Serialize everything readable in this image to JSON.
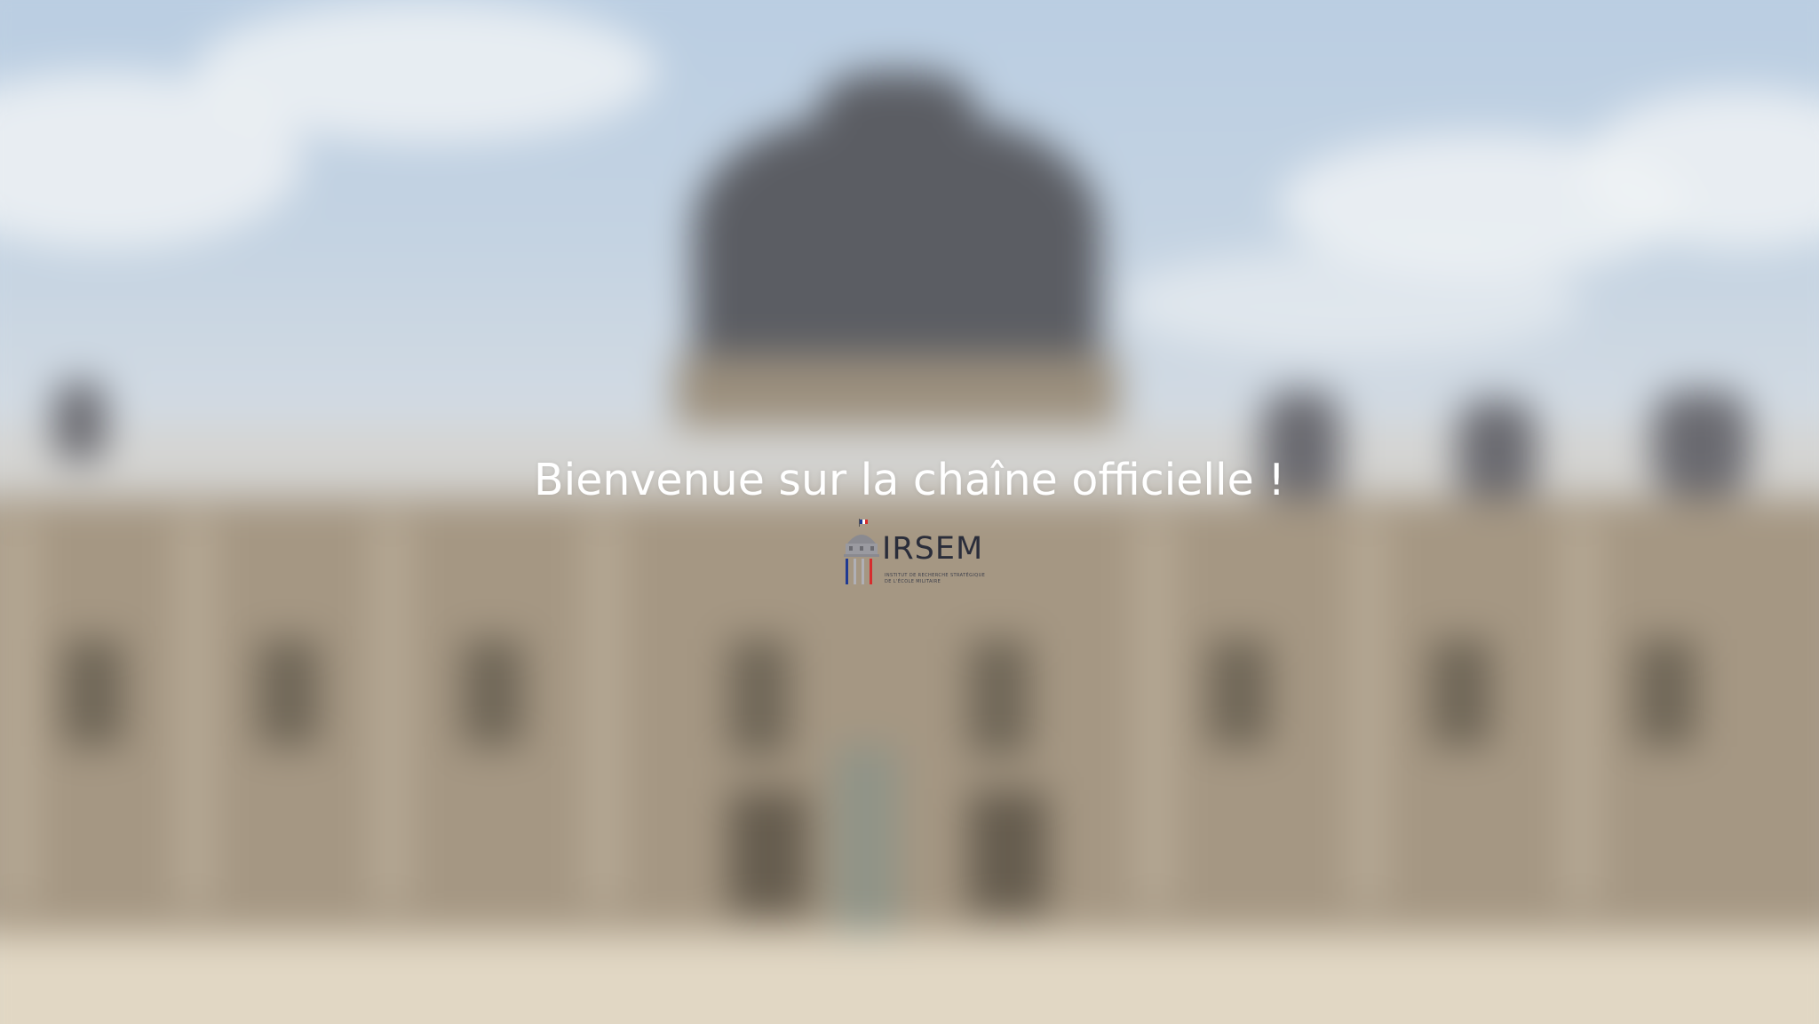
{
  "welcome": {
    "title": "Bienvenue sur la chaîne officielle !"
  },
  "logo": {
    "name": "IRSEM",
    "subtitle_line1": "INSTITUT DE RECHERCHE STRATÉGIQUE",
    "subtitle_line2": "DE L'ÉCOLE MILITAIRE",
    "icon": "irsem-building-flag-icon",
    "colors": {
      "blue": "#1f3a93",
      "white": "#ffffff",
      "red": "#d62d2d",
      "text": "#2a2d3a"
    }
  },
  "background": {
    "icon": "ecole-militaire-building-photo"
  }
}
